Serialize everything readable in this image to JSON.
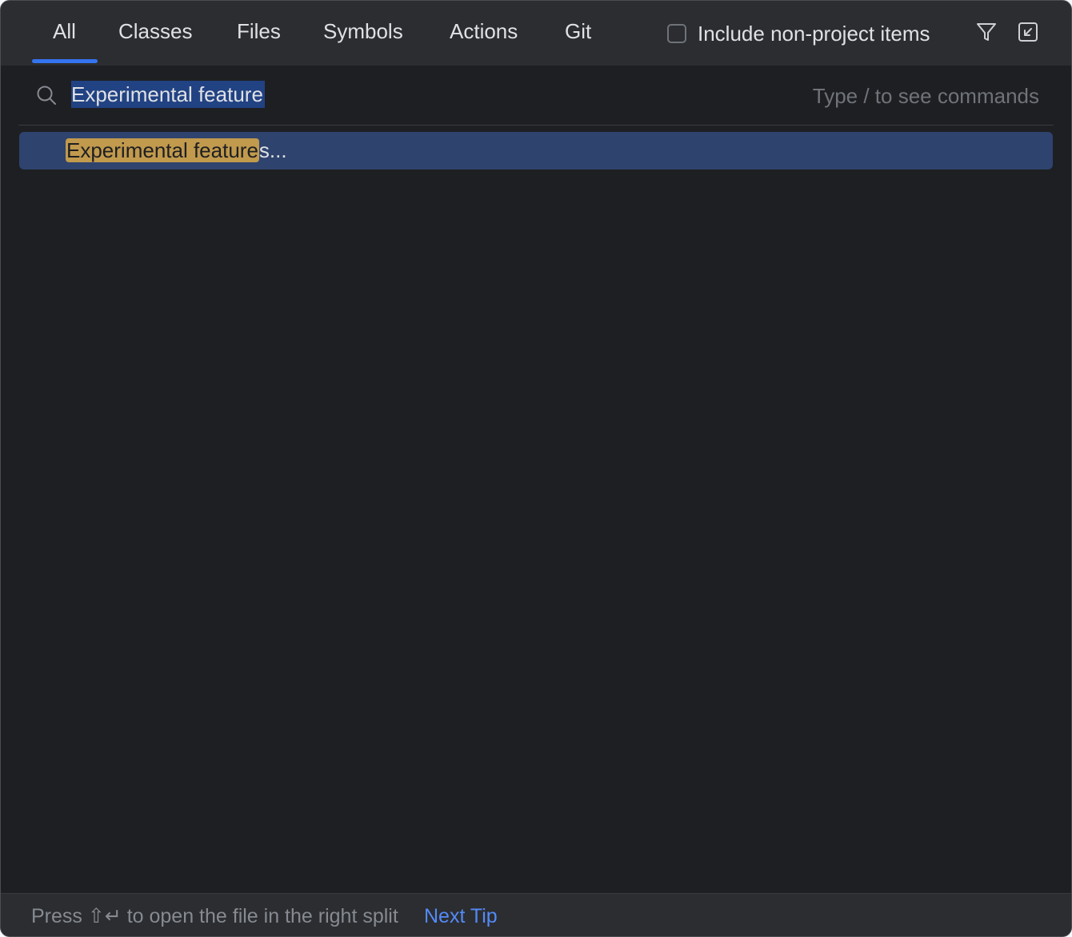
{
  "tabs": [
    {
      "label": "All",
      "active": true
    },
    {
      "label": "Classes"
    },
    {
      "label": "Files"
    },
    {
      "label": "Symbols"
    },
    {
      "label": "Actions"
    },
    {
      "label": "Git"
    }
  ],
  "include_non_project": {
    "label": "Include non-project items",
    "checked": false
  },
  "icons": {
    "filter": "filter-icon",
    "collapse": "collapse-to-corner-icon",
    "search": "search-icon"
  },
  "search": {
    "value": "Experimental feature",
    "hint": "Type / to see commands"
  },
  "results": [
    {
      "match": "Experimental feature",
      "rest": "s..."
    }
  ],
  "footer": {
    "tip": "Press ⇧↵ to open the file in the right split",
    "next_tip": "Next Tip"
  },
  "colors": {
    "accent": "#3574f0",
    "selection": "#2e436e",
    "match_highlight": "#c19a4d",
    "link": "#548af7"
  }
}
